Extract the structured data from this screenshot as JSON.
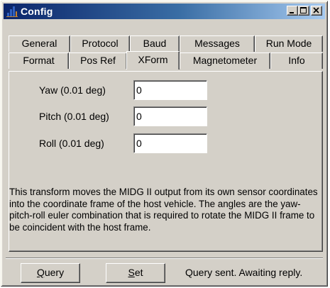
{
  "window": {
    "title": "Config"
  },
  "tabs_row1": [
    "General",
    "Protocol",
    "Baud",
    "Messages",
    "Run Mode"
  ],
  "tabs_row2": [
    "Format",
    "Pos Ref",
    "XForm",
    "Magnetometer",
    "Info"
  ],
  "active_tab": "XForm",
  "fields": {
    "yaw": {
      "label": "Yaw (0.01 deg)",
      "value": "0"
    },
    "pitch": {
      "label": "Pitch (0.01 deg)",
      "value": "0"
    },
    "roll": {
      "label": "Roll (0.01 deg)",
      "value": "0"
    }
  },
  "description": "This transform moves the MIDG II output from its own sensor coordinates into the coordinate frame of the host vehicle. The angles are the yaw-pitch-roll euler combination that is required to rotate the MIDG II frame to be coincident with the host frame.",
  "buttons": {
    "query": {
      "accel": "Q",
      "rest": "uery"
    },
    "set": {
      "accel": "S",
      "rest": "et"
    }
  },
  "status": "Query sent. Awaiting reply."
}
